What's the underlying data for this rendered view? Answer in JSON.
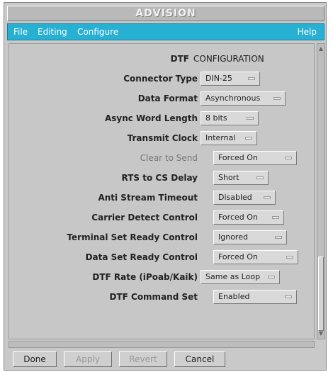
{
  "window": {
    "title": "ADVISION"
  },
  "menubar": {
    "items": [
      "File",
      "Editing",
      "Configure"
    ],
    "help": "Help",
    "bg_color": "#28b0d2"
  },
  "heading": {
    "prefix": "DTF",
    "title": "CONFIGURATION"
  },
  "fields": [
    {
      "label": "Connector Type",
      "value": "DIN-25"
    },
    {
      "label": "Data Format",
      "value": "Asynchronous"
    },
    {
      "label": "Async Word Length",
      "value": "8 bits"
    },
    {
      "label": "Transmit Clock",
      "value": "Internal"
    },
    {
      "label": "Clear to Send",
      "value": "Forced On",
      "dimmed": true
    },
    {
      "label": "RTS to CS Delay",
      "value": "Short",
      "dimmed": true
    },
    {
      "label": "Anti Stream Timeout",
      "value": "Disabled",
      "dimmed": true
    },
    {
      "label": "Carrier Detect Control",
      "value": "Forced On"
    },
    {
      "label": "Terminal Set Ready Control",
      "value": "Ignored"
    },
    {
      "label": "Data Set Ready Control",
      "value": "Forced On"
    },
    {
      "label": "DTF Rate (iPoab/Kaik)",
      "value": "Same as Loop"
    },
    {
      "label": "DTF Command Set",
      "value": "Enabled"
    }
  ],
  "buttons": {
    "done": "Done",
    "apply": "Apply",
    "revert": "Revert",
    "cancel": "Cancel"
  }
}
